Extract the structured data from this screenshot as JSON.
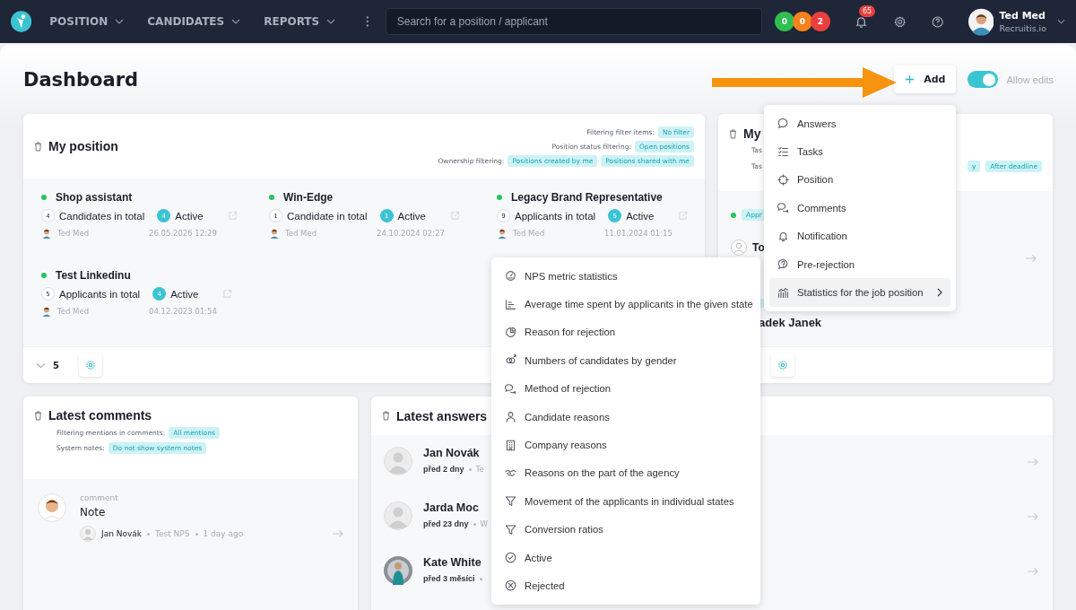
{
  "nav": {
    "menus": [
      {
        "label": "POSITION"
      },
      {
        "label": "CANDIDATES"
      },
      {
        "label": "REPORTS"
      }
    ],
    "search": {
      "placeholder": "Search for a position / applicant"
    },
    "counters": [
      {
        "value": "0",
        "color": "#2fbf4f"
      },
      {
        "value": "0",
        "color": "#f7821b"
      },
      {
        "value": "2",
        "color": "#e9403f"
      }
    ],
    "notifications": "65",
    "user": {
      "name": "Ted Med",
      "company": "Recruitis.io"
    }
  },
  "page": {
    "title": "Dashboard",
    "add_button": "Add",
    "allow_edits": {
      "label": "Allow edits",
      "on": true
    }
  },
  "my_position": {
    "title": "My position",
    "filters": [
      {
        "label": "Filtering filter items:",
        "tags": [
          "No filter"
        ]
      },
      {
        "label": "Position status filtering:",
        "tags": [
          "Open positions"
        ]
      },
      {
        "label": "Ownership filtering:",
        "tags": [
          "Positions created by me",
          "Positions shared with me"
        ]
      }
    ],
    "positions": [
      {
        "name": "Shop assistant",
        "total": "4",
        "total_label": "Candidates in total",
        "active": "4",
        "active_label": "Active",
        "owner": "Ted Med",
        "date": "26.05.2026 12:29"
      },
      {
        "name": "Win-Edge",
        "total": "1",
        "total_label": "Candidate in total",
        "active": "1",
        "active_label": "Active",
        "owner": "Ted Med",
        "date": "24.10.2024 02:27"
      },
      {
        "name": "Legacy Brand Representative",
        "total": "9",
        "total_label": "Applicants in total",
        "active": "5",
        "active_label": "Active",
        "owner": "Ted Med",
        "date": "11.01.2024 01:15"
      },
      {
        "name": "Test Linkedinu",
        "total": "5",
        "total_label": "Applicants in total",
        "active": "4",
        "active_label": "Active",
        "owner": "Ted Med",
        "date": "04.12.2023 01:54"
      }
    ],
    "count": "5"
  },
  "my_tasks": {
    "title": "My",
    "filters": [
      {
        "label": "Tas"
      },
      {
        "label": "Tas",
        "tags": [
          "y",
          "After deadline"
        ]
      }
    ],
    "tag": "Appr",
    "person": "To",
    "name": "adek Janek"
  },
  "latest_comments": {
    "title": "Latest comments",
    "filters": [
      {
        "label": "Filtering mentions in comments:",
        "tags": [
          "All mentions"
        ]
      },
      {
        "label": "System notes:",
        "tags": [
          "Do not show system notes"
        ]
      }
    ],
    "comments": [
      {
        "type": "comment",
        "text": "Note",
        "author": "Jan Novák",
        "position": "Test NPS",
        "time": "1 day ago"
      }
    ]
  },
  "latest_answers": {
    "title": "Latest answers",
    "answers": [
      {
        "name": "Jan Novák",
        "time": "před 2 dny",
        "detail": "Te",
        "kind": "placeholder"
      },
      {
        "name": "Jarda Moc",
        "time": "před 23 dny",
        "detail": "W",
        "kind": "placeholder"
      },
      {
        "name": "Kate White",
        "time": "před 3 měsíci",
        "kind": "photo"
      }
    ]
  },
  "add_menu": {
    "items": [
      {
        "label": "Answers",
        "selected": false
      },
      {
        "label": "Tasks",
        "selected": false
      },
      {
        "label": "Position",
        "selected": false
      },
      {
        "label": "Comments",
        "selected": false
      },
      {
        "label": "Notification",
        "selected": false
      },
      {
        "label": "Pre-rejection",
        "selected": false
      },
      {
        "label": "Statistics for the job position",
        "submenu": true,
        "selected": true
      }
    ]
  },
  "stats_menu": {
    "items": [
      {
        "label": "NPS metric statistics"
      },
      {
        "label": "Average time spent by applicants in the given state"
      },
      {
        "label": "Reason for rejection"
      },
      {
        "label": "Numbers of candidates by gender"
      },
      {
        "label": "Method of rejection"
      },
      {
        "label": "Candidate reasons"
      },
      {
        "label": "Company reasons"
      },
      {
        "label": "Reasons on the part of the agency"
      },
      {
        "label": "Movement of the applicants in individual states"
      },
      {
        "label": "Conversion ratios"
      },
      {
        "label": "Active"
      },
      {
        "label": "Rejected"
      }
    ]
  }
}
